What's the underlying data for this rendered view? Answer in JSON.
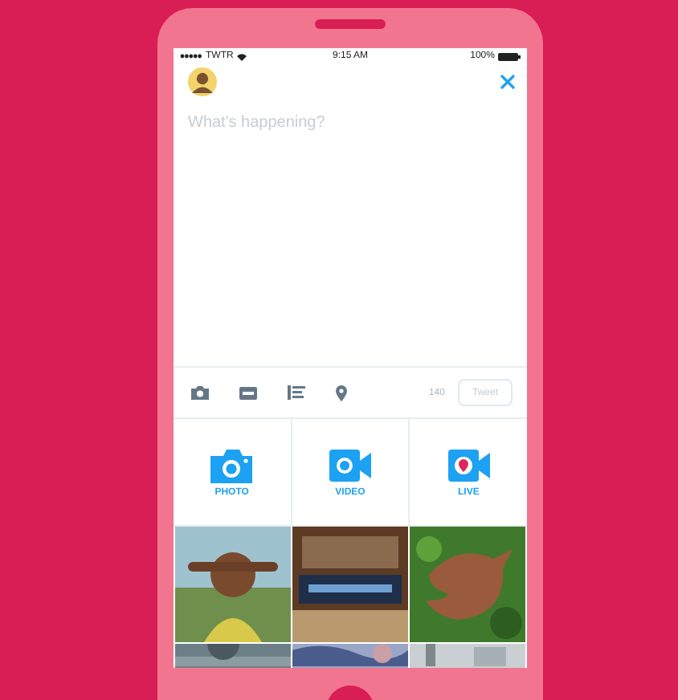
{
  "status_bar": {
    "carrier": "TWTR",
    "time": "9:15 AM",
    "battery": "100%"
  },
  "compose": {
    "placeholder": "What's happening?"
  },
  "toolbar": {
    "count": "140",
    "tweet_button": {
      "label": "Tweet",
      "disabled": true
    }
  },
  "media_buttons": [
    {
      "label": "PHOTO"
    },
    {
      "kind": "video",
      "label": "VIDEO"
    },
    {
      "kind": "live",
      "label": "LIVE"
    }
  ]
}
